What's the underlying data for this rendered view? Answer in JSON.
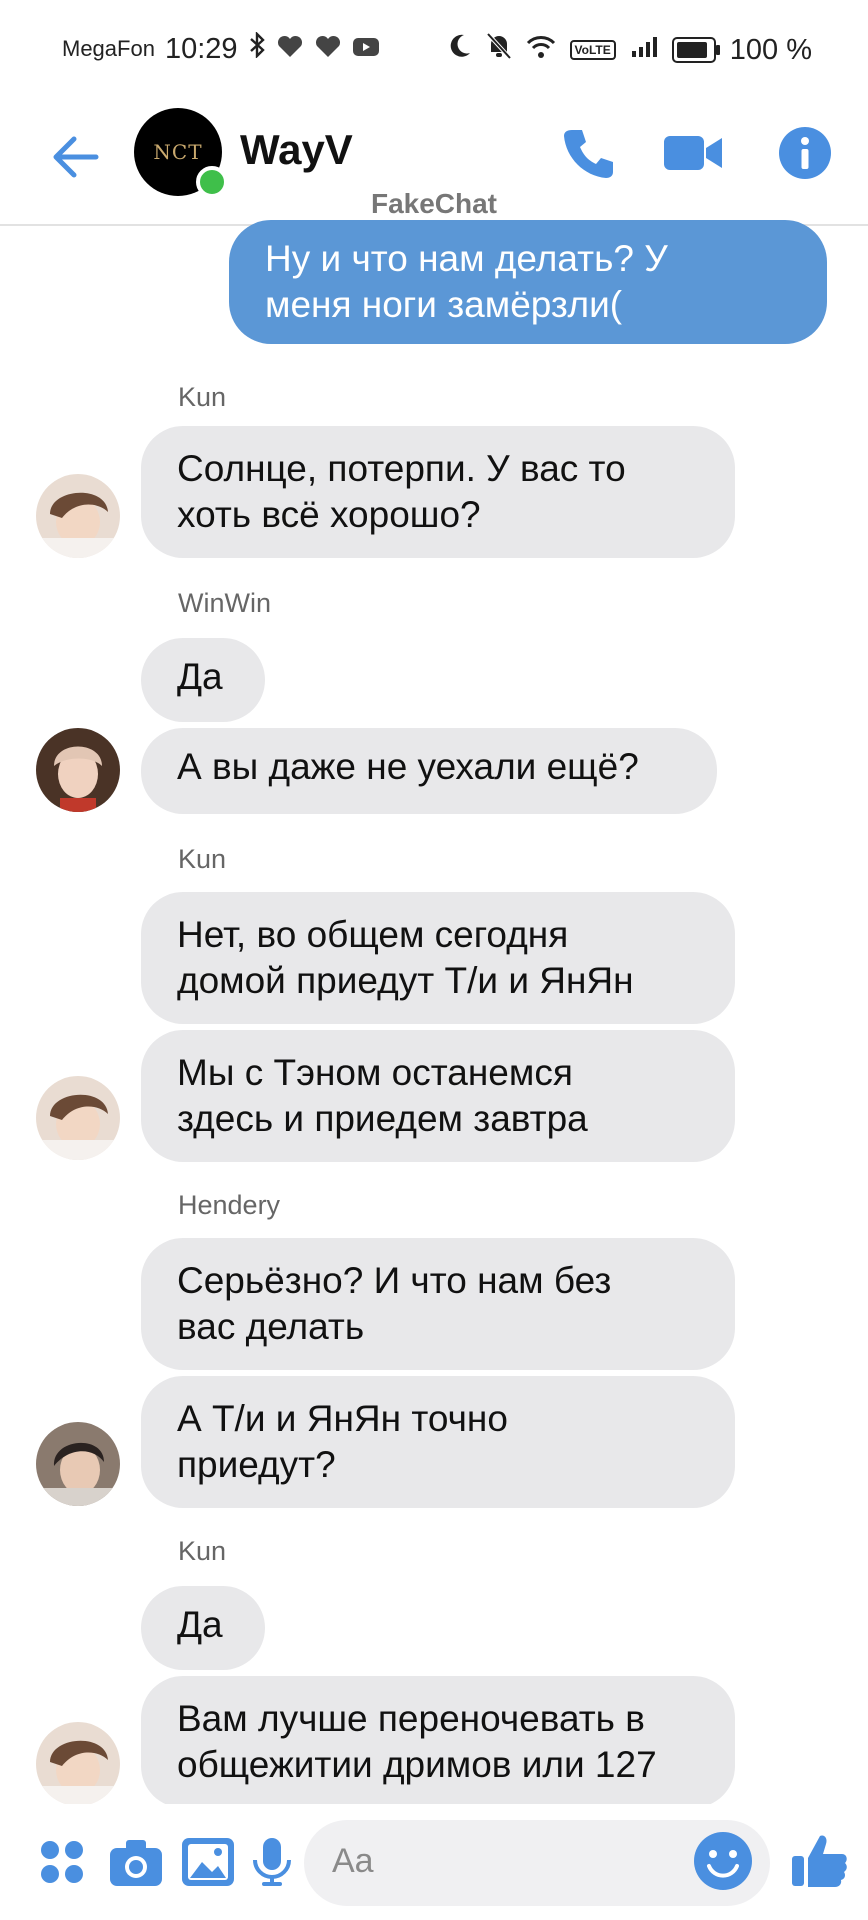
{
  "status_bar": {
    "carrier": "MegaFon",
    "time": "10:29",
    "volte": "VoLTE",
    "battery_text": "100 %",
    "battery_level": 1.0
  },
  "header": {
    "title": "WayV",
    "avatar_text": "NCT",
    "watermark": "FakeChat",
    "online_color": "#3fbf4a",
    "accent_color": "#4a8fe0"
  },
  "messages": [
    {
      "kind": "outgoing",
      "lines": [
        "Ну и что нам делать? У",
        "меня ноги замёрзли("
      ]
    },
    {
      "kind": "sender",
      "text": "Kun"
    },
    {
      "kind": "incoming",
      "lines": [
        "Солнце, потерпи. У вас то",
        "хоть всё хорошо?"
      ]
    },
    {
      "kind": "sender",
      "text": "WinWin"
    },
    {
      "kind": "incoming",
      "lines": [
        "Да"
      ]
    },
    {
      "kind": "incoming",
      "lines": [
        "А вы даже не уехали ещё?"
      ]
    },
    {
      "kind": "sender",
      "text": "Kun"
    },
    {
      "kind": "incoming",
      "lines": [
        "Нет, во общем сегодня",
        "домой приедут Т/и и ЯнЯн"
      ]
    },
    {
      "kind": "incoming",
      "lines": [
        "Мы с Тэном останемся",
        "здесь и приедем завтра"
      ]
    },
    {
      "kind": "sender",
      "text": "Hendery"
    },
    {
      "kind": "incoming",
      "lines": [
        "Серьёзно? И что нам без",
        "вас делать"
      ]
    },
    {
      "kind": "incoming",
      "lines": [
        "А Т/и и ЯнЯн точно",
        "приедут?"
      ]
    },
    {
      "kind": "sender",
      "text": "Kun"
    },
    {
      "kind": "incoming",
      "lines": [
        "Да"
      ]
    },
    {
      "kind": "incoming",
      "lines": [
        "Вам лучше переночевать в",
        "общежитии дримов или 127"
      ]
    }
  ],
  "composer": {
    "placeholder": "Aa",
    "icons": [
      "apps-icon",
      "camera-icon",
      "gallery-icon",
      "microphone-icon",
      "emoji-icon",
      "thumbs-up-icon"
    ]
  },
  "bubble_colors": {
    "incoming": "#e8e8ea",
    "outgoing": "#5b97d6"
  }
}
